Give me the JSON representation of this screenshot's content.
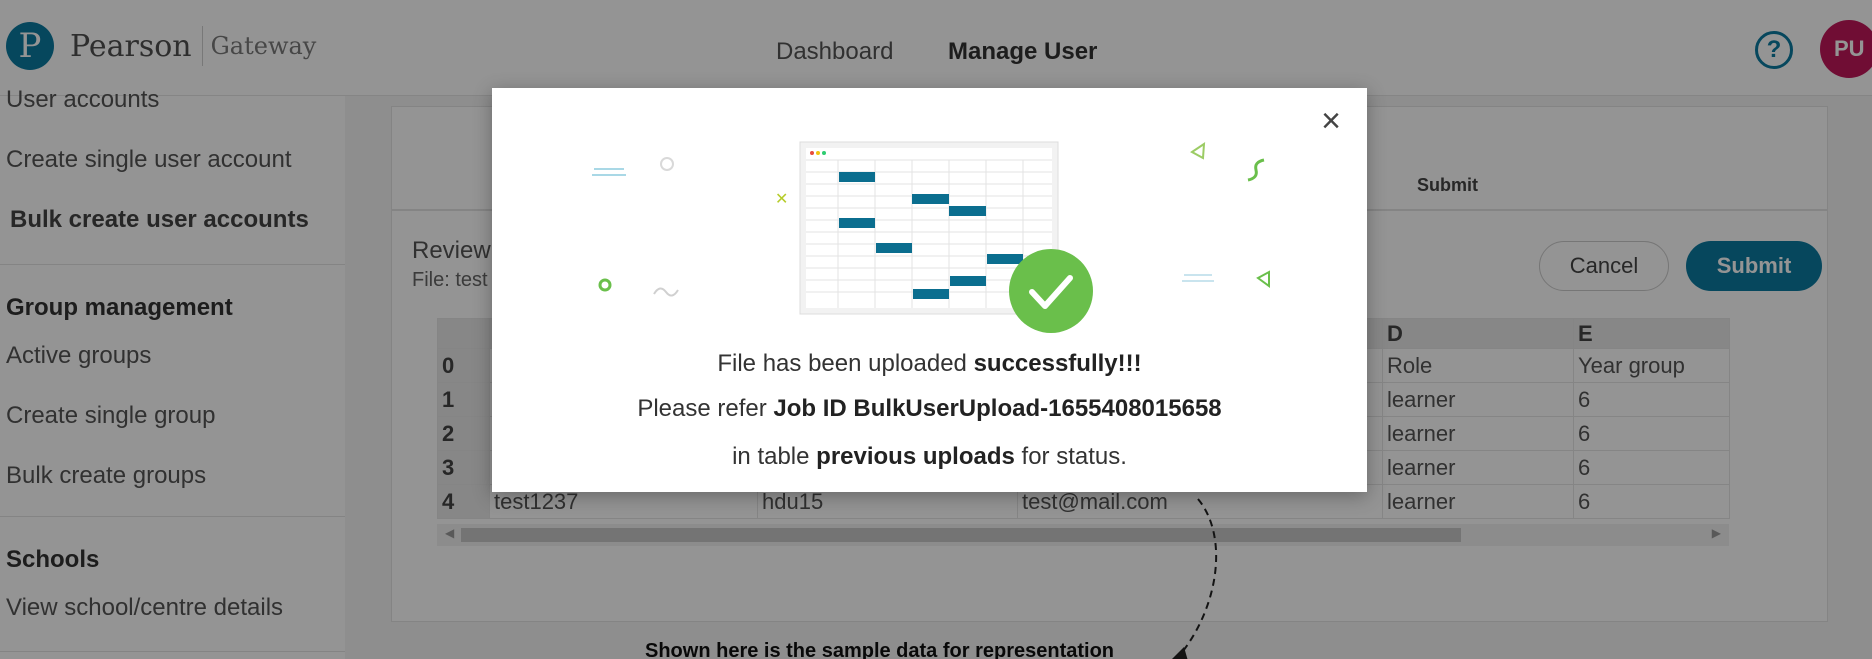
{
  "header": {
    "logo_word": "Pearson",
    "logo_sub": "Gateway",
    "nav": [
      "Dashboard",
      "Manage User"
    ],
    "help_symbol": "?",
    "avatar_initials": "PU"
  },
  "sidebar": {
    "items": [
      {
        "label": "User accounts"
      },
      {
        "label": "Create single user account"
      },
      {
        "label": "Bulk create user accounts"
      },
      {
        "label": "Group management"
      },
      {
        "label": "Active groups"
      },
      {
        "label": "Create single group"
      },
      {
        "label": "Bulk create groups"
      },
      {
        "label": "Schools"
      },
      {
        "label": "View school/centre details"
      }
    ]
  },
  "stepper": {
    "submit_label": "Submit"
  },
  "review": {
    "title": "Review",
    "file_label": "File: test"
  },
  "buttons": {
    "cancel": "Cancel",
    "submit": "Submit"
  },
  "sheet": {
    "columns": [
      "D",
      "E"
    ],
    "rows": [
      {
        "idx": "0",
        "d": "Role",
        "e": "Year group"
      },
      {
        "idx": "1",
        "d": "learner",
        "e": "6"
      },
      {
        "idx": "2",
        "d": "learner",
        "e": "6"
      },
      {
        "idx": "3",
        "d": "learner",
        "e": "6"
      },
      {
        "idx": "4",
        "a": "test1237",
        "b": "hdu15",
        "c": "test@mail.com",
        "d": "learner",
        "e": "6"
      }
    ]
  },
  "annotation": "Shown here is the sample data for representation",
  "modal": {
    "line1_pre": "File has been uploaded ",
    "line1_bold": "successfully!!!",
    "line2_pre": "Please refer ",
    "line2_bold": "Job ID BulkUserUpload-1655408015658",
    "line3_pre": "in table ",
    "line3_bold": "previous uploads",
    "line3_post": " for status.",
    "close_symbol": "×"
  },
  "colors": {
    "brand": "#0b7aa1",
    "success": "#6abf4b",
    "avatar": "#c2185b",
    "overlay": "rgba(0,0,0,0.42)"
  }
}
